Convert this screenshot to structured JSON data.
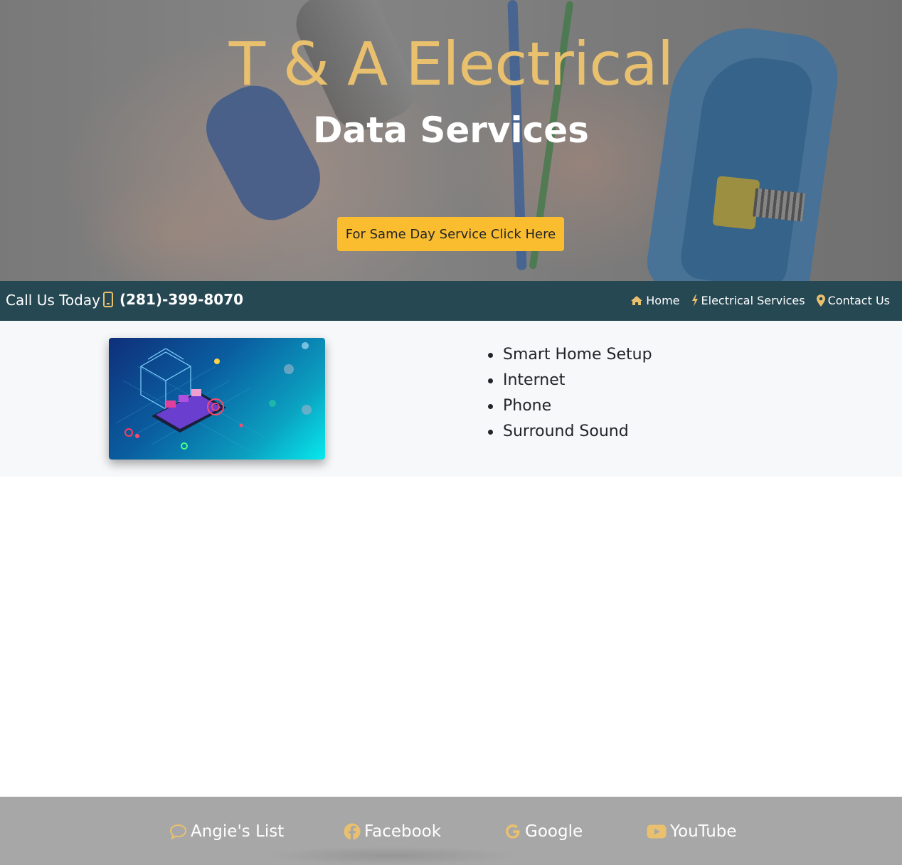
{
  "hero": {
    "title": "T & A Electrical",
    "subtitle": "Data Services",
    "cta_label": "For Same Day Service Click Here"
  },
  "navbar": {
    "call_label": "Call Us Today",
    "phone_number": "(281)-399-8070",
    "links": [
      {
        "label": "Home",
        "icon": "home-icon"
      },
      {
        "label": "Electrical Services",
        "icon": "bolt-icon"
      },
      {
        "label": "Contact Us",
        "icon": "map-marker-icon"
      }
    ]
  },
  "services": {
    "items": [
      "Smart Home Setup",
      "Internet",
      "Phone",
      "Surround Sound"
    ]
  },
  "footer": {
    "links": [
      {
        "label": "Angie's List",
        "icon": "comment-icon"
      },
      {
        "label": "Facebook",
        "icon": "facebook-icon"
      },
      {
        "label": "Google",
        "icon": "google-icon"
      },
      {
        "label": "YouTube",
        "icon": "youtube-icon"
      }
    ]
  },
  "colors": {
    "accent_gold": "#e9c06e",
    "button_yellow": "#fbbd30",
    "navbar_bg": "#264853",
    "footer_bg": "#a7a7a7"
  }
}
